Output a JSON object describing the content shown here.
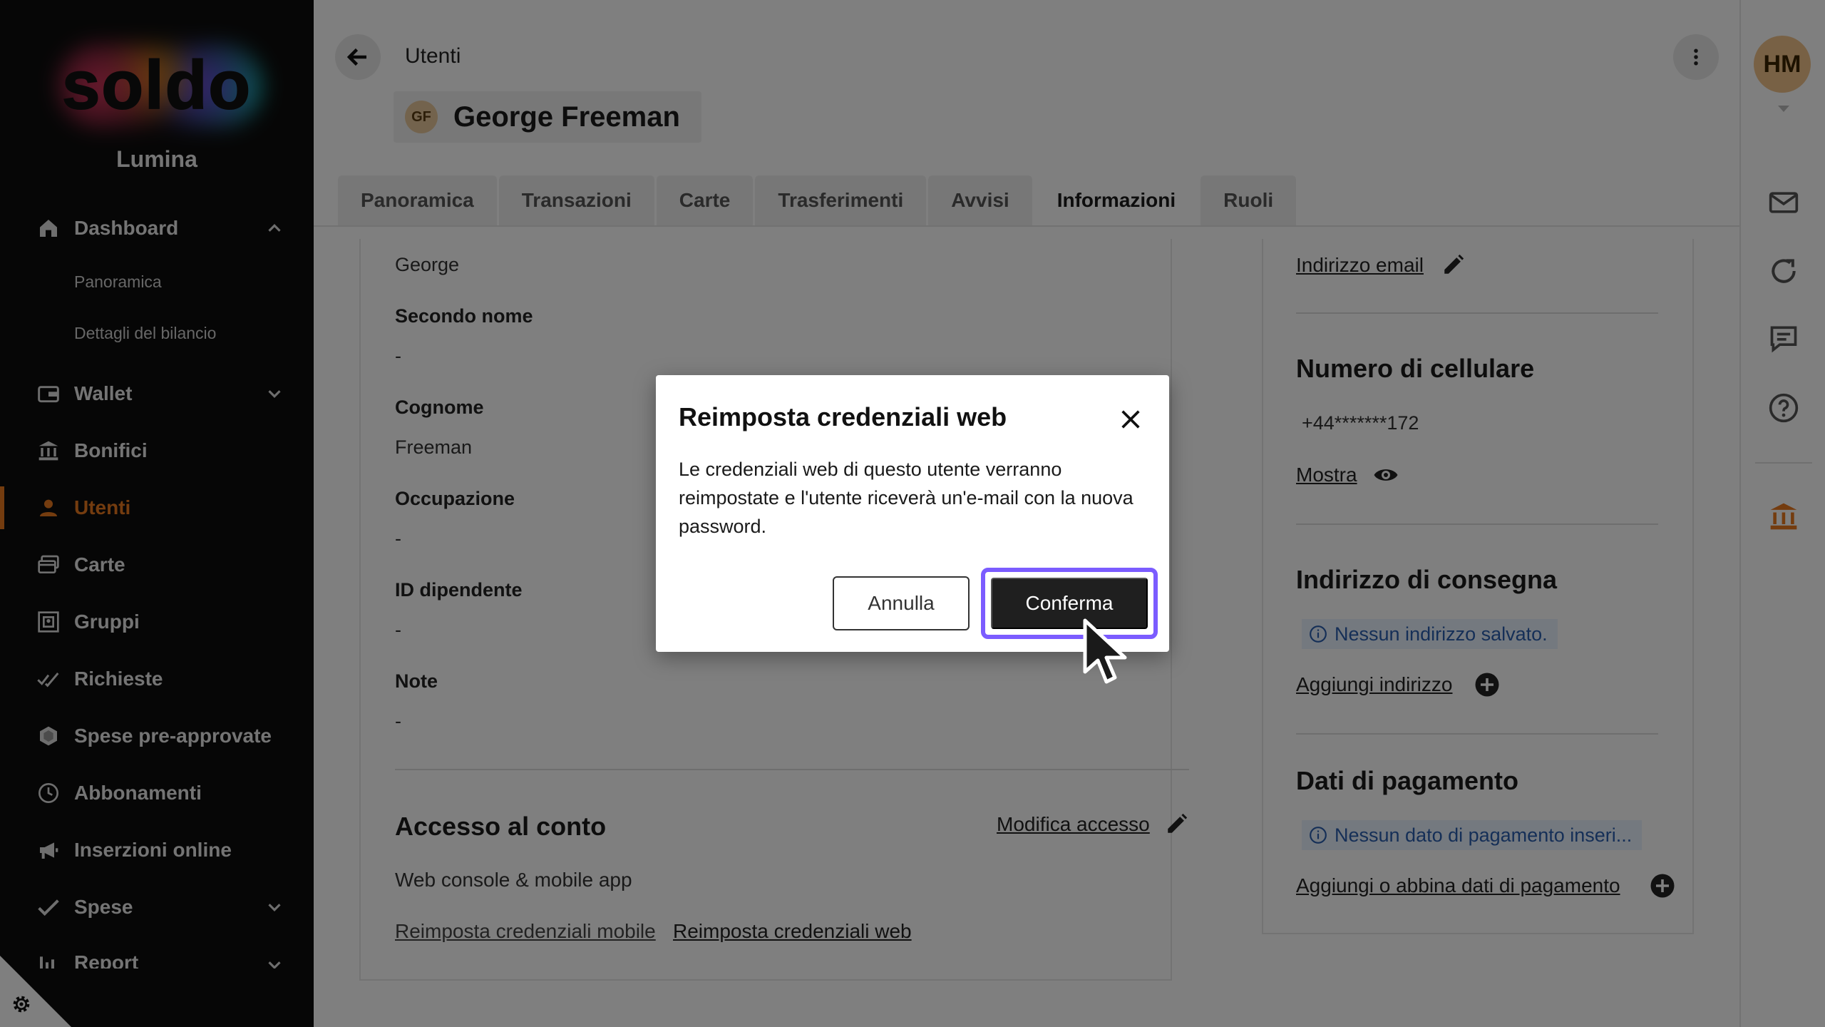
{
  "sidebar": {
    "logo": "soldo",
    "org_name": "Lumina",
    "items": [
      {
        "label": "Dashboard",
        "icon": "home-icon",
        "expanded": true
      },
      {
        "label": "Wallet",
        "icon": "wallet-icon"
      },
      {
        "label": "Bonifici",
        "icon": "bank-transfer-icon"
      },
      {
        "label": "Utenti",
        "icon": "user-icon",
        "active": true
      },
      {
        "label": "Carte",
        "icon": "cards-icon"
      },
      {
        "label": "Gruppi",
        "icon": "groups-icon"
      },
      {
        "label": "Richieste",
        "icon": "requests-icon"
      },
      {
        "label": "Spese pre-approvate",
        "icon": "pre-approved-icon"
      },
      {
        "label": "Abbonamenti",
        "icon": "clock-icon"
      },
      {
        "label": "Inserzioni online",
        "icon": "megaphone-icon"
      },
      {
        "label": "Spese",
        "icon": "check-icon"
      },
      {
        "label": "Report",
        "icon": "chart-icon"
      }
    ],
    "dashboard_sub": [
      "Panoramica",
      "Dettagli del bilancio"
    ],
    "accent": "#e8781f"
  },
  "header": {
    "breadcrumb": "Utenti",
    "user_initials": "GF",
    "user_name": "George Freeman"
  },
  "tabs": [
    "Panoramica",
    "Transazioni",
    "Carte",
    "Trasferimenti",
    "Avvisi",
    "Informazioni",
    "Ruoli"
  ],
  "active_tab": "Informazioni",
  "details": {
    "first_name_value": "George",
    "middle_name_label": "Secondo nome",
    "middle_name_value": "-",
    "last_name_label": "Cognome",
    "last_name_value": "Freeman",
    "occupation_label": "Occupazione",
    "occupation_value": "-",
    "employee_id_label": "ID dipendente",
    "employee_id_value": "-",
    "notes_label": "Note",
    "notes_value": "-"
  },
  "access": {
    "title": "Accesso al conto",
    "edit_link": "Modifica accesso",
    "type": "Web console & mobile app",
    "reset_mobile": "Reimposta credenziali mobile",
    "reset_web": "Reimposta credenziali web"
  },
  "contact": {
    "email_link": "Indirizzo email",
    "phone_title": "Numero di cellulare",
    "phone_value": "+44*******172",
    "show_link": "Mostra",
    "delivery_title": "Indirizzo di consegna",
    "delivery_info": "Nessun indirizzo salvato.",
    "add_address": "Aggiungi indirizzo",
    "payment_title": "Dati di pagamento",
    "payment_info": "Nessun dato di pagamento inseri...",
    "add_payment": "Aggiungi o abbina dati di pagamento"
  },
  "rail": {
    "avatar_initials": "HM"
  },
  "dialog": {
    "title": "Reimposta credenziali web",
    "body": "Le credenziali web di questo utente verranno reimpostate e l'utente riceverà un'e-mail con la nuova password.",
    "cancel_label": "Annulla",
    "confirm_label": "Conferma",
    "focus_ring_color": "#7b5cff"
  }
}
